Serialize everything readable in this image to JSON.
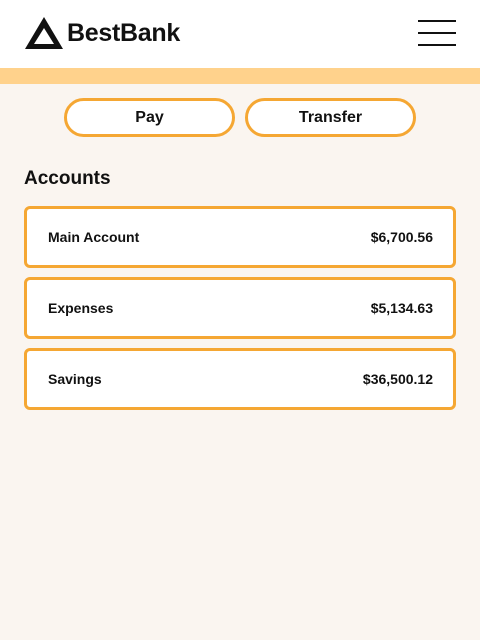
{
  "header": {
    "brand": "BestBank",
    "logo_icon": "triangle-logo-icon",
    "menu_icon": "hamburger-menu-icon"
  },
  "actions": {
    "pay_label": "Pay",
    "transfer_label": "Transfer"
  },
  "accounts": {
    "title": "Accounts",
    "items": [
      {
        "name": "Main Account",
        "balance": "$6,700.56"
      },
      {
        "name": "Expenses",
        "balance": "$5,134.63"
      },
      {
        "name": "Savings",
        "balance": "$36,500.12"
      }
    ]
  },
  "colors": {
    "accent_border": "#f5a733",
    "accent_strip": "#ffd28c",
    "page_background": "#faf5f0",
    "header_background": "#ffffff"
  }
}
